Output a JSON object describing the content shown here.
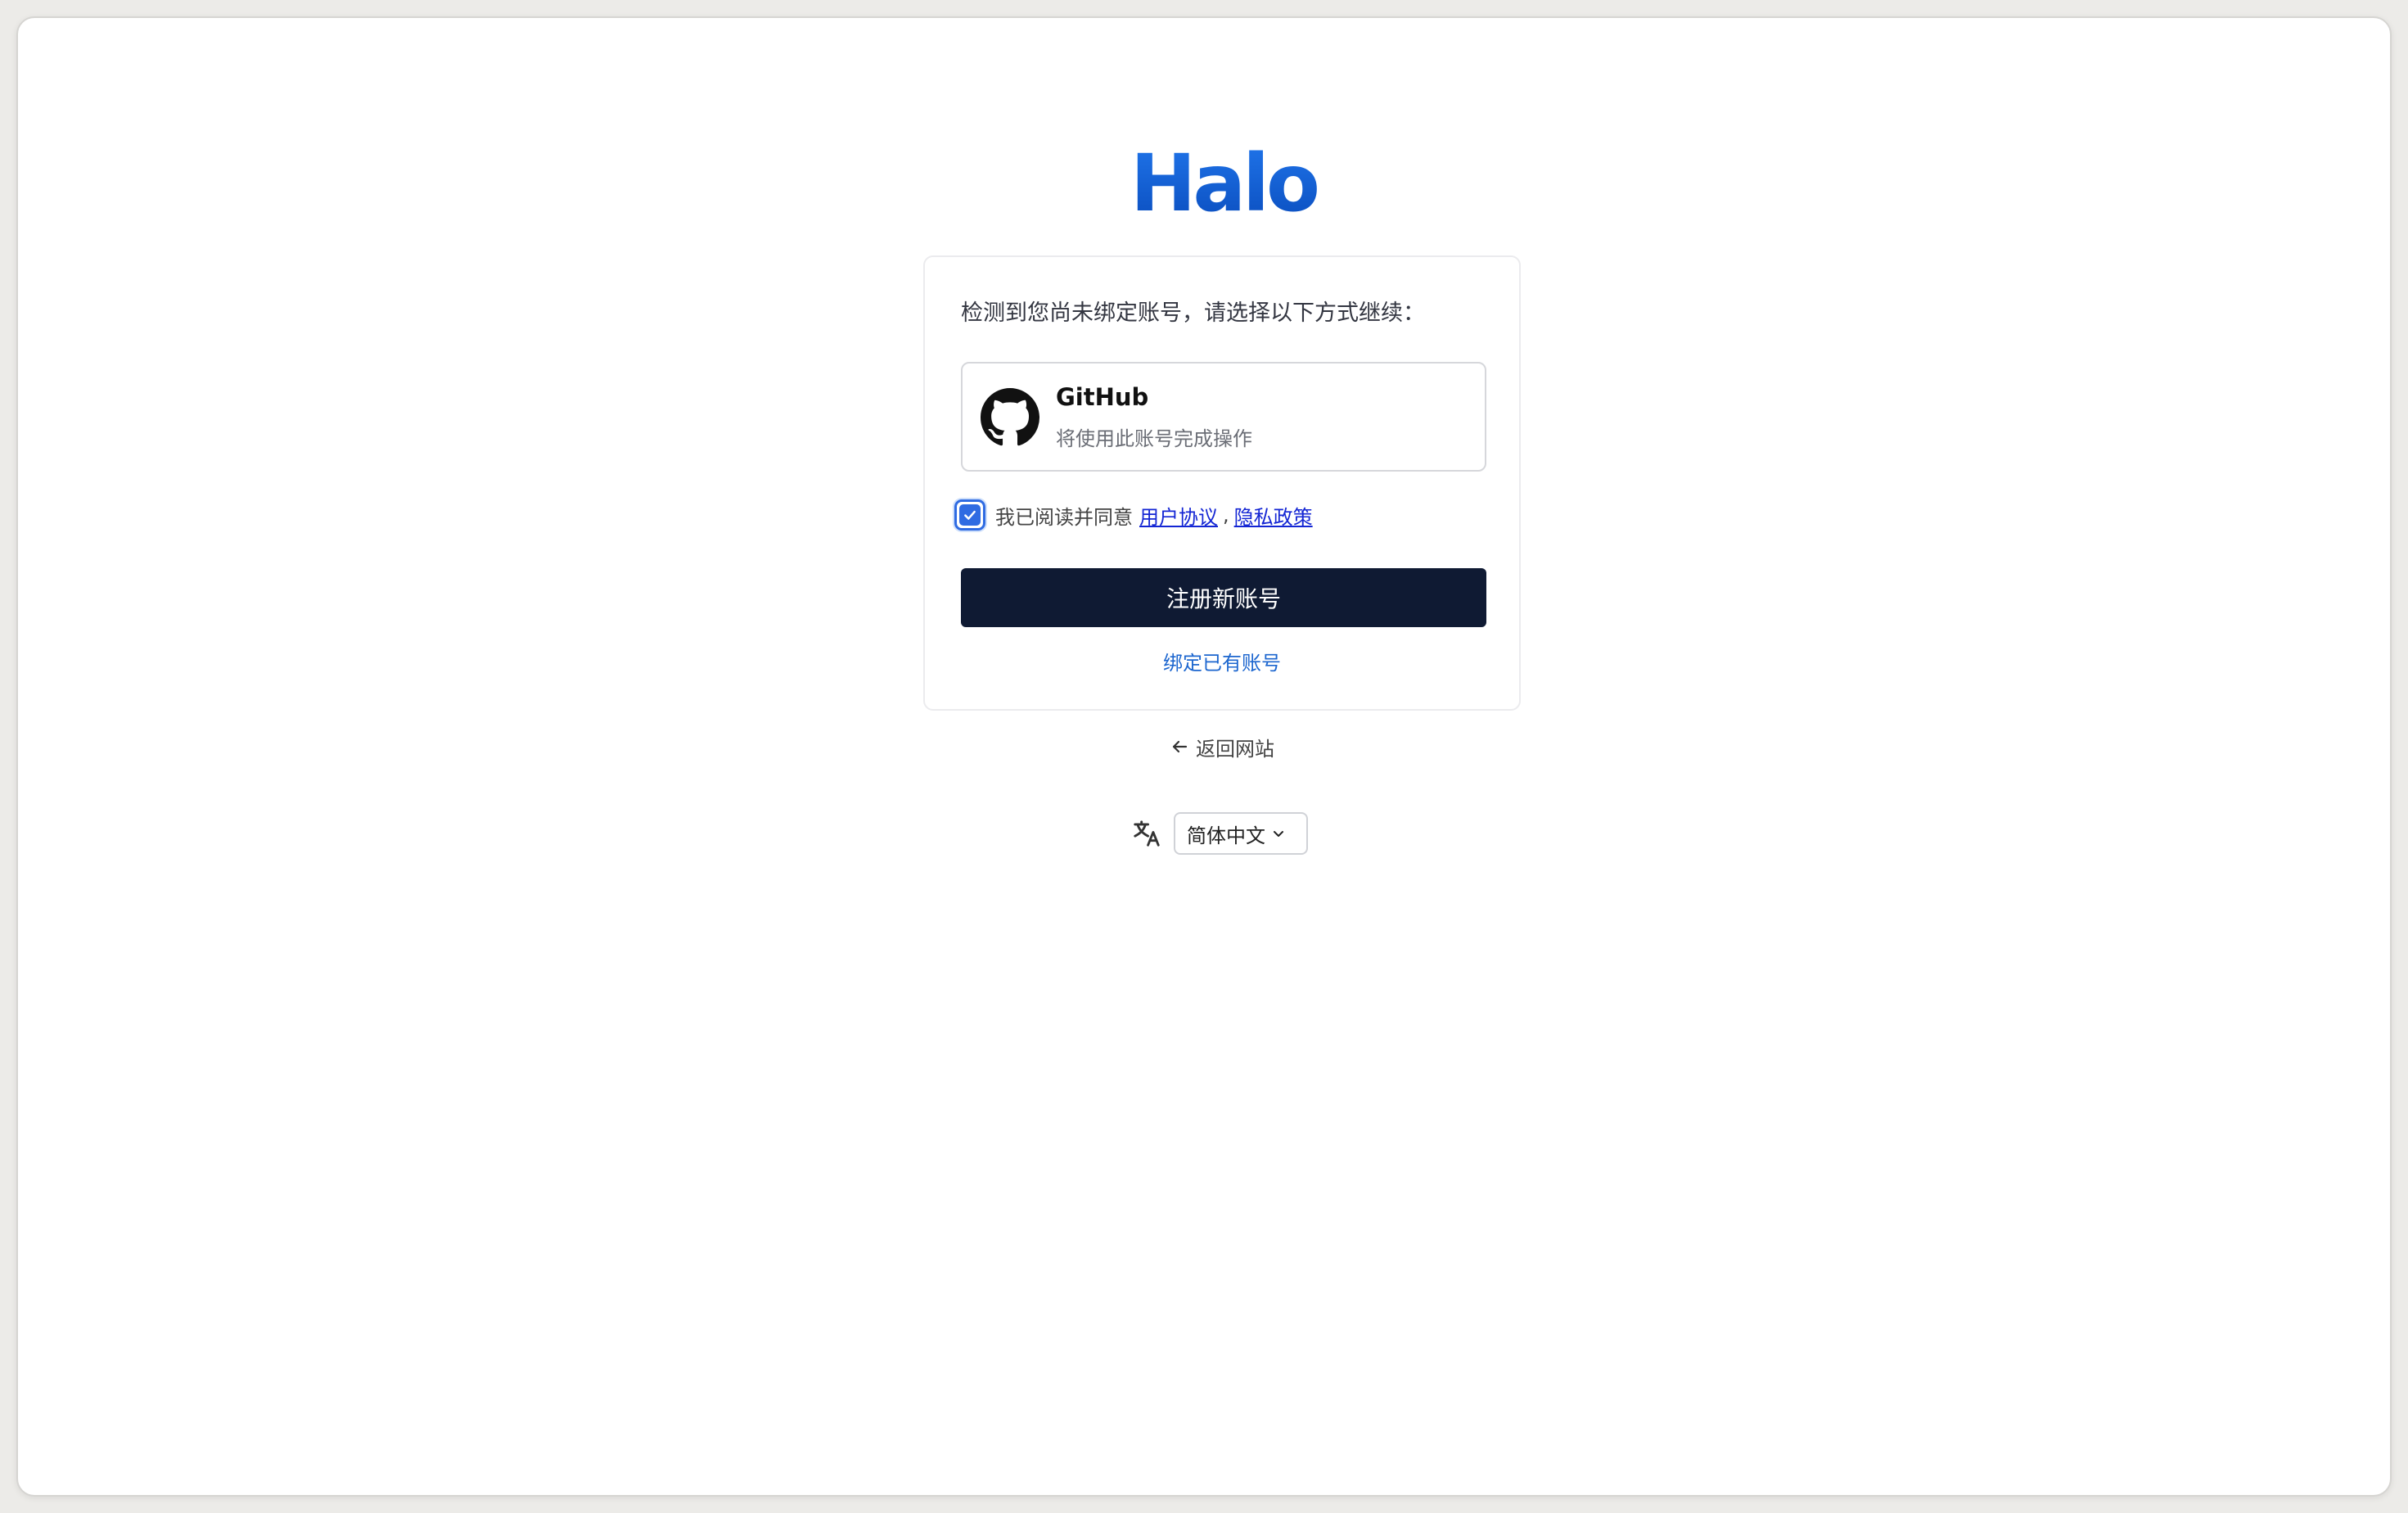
{
  "logo": {
    "text": "Halo"
  },
  "card": {
    "title": "检测到您尚未绑定账号，请选择以下方式继续：",
    "provider": {
      "name": "GitHub",
      "description": "将使用此账号完成操作",
      "icon": "github-icon"
    },
    "agreement": {
      "checked": true,
      "prefix": "我已阅读并同意",
      "terms_link": "用户协议",
      "separator": ",",
      "privacy_link": "隐私政策"
    },
    "register_button": "注册新账号",
    "bind_existing_link": "绑定已有账号"
  },
  "back_link": {
    "label": "返回网站",
    "icon": "arrow-left-icon"
  },
  "language": {
    "icon": "translate-icon",
    "selected": "简体中文"
  },
  "colors": {
    "brand": "#1a5fd6",
    "primary_button": "#0f1a33",
    "link": "#1c66cf",
    "checkbox": "#2f6be2"
  }
}
